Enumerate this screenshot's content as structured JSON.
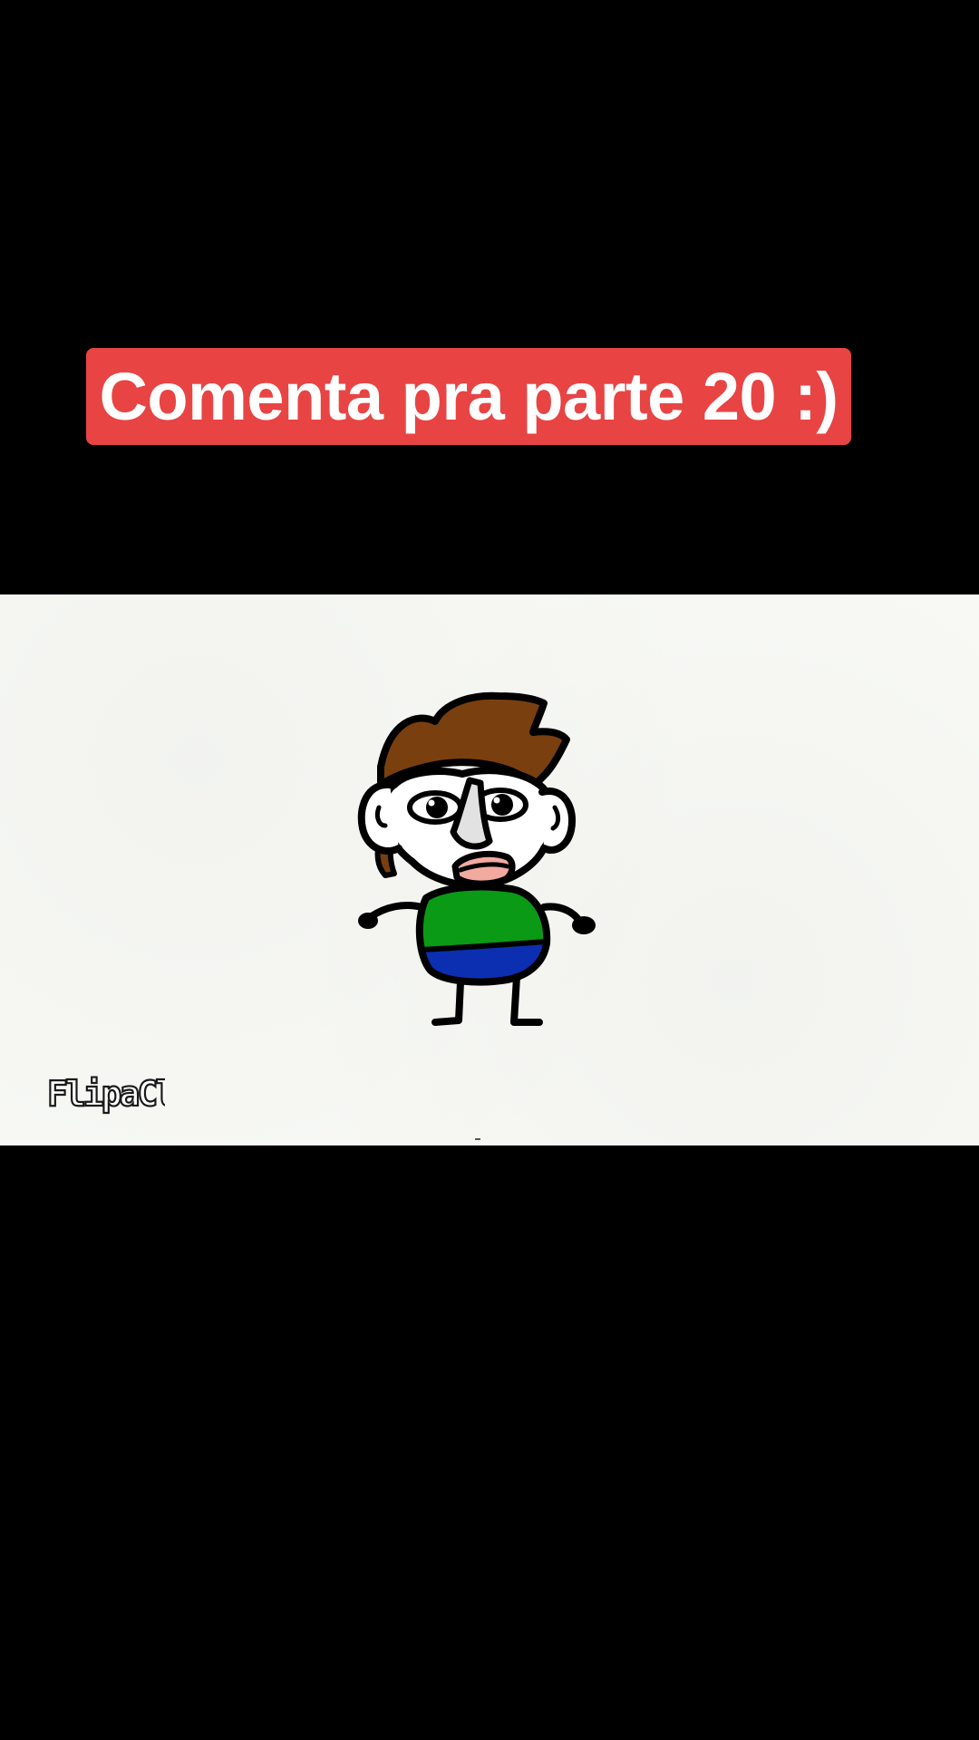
{
  "caption": {
    "text": "Comenta pra parte 20 :)",
    "background_color": "#e84444",
    "text_color": "#ffffff"
  },
  "video": {
    "background_color": "#f8f9f5",
    "watermark": "FlipaClip",
    "character": {
      "hair_color": "#7a3f0f",
      "shirt_color": "#0a9a16",
      "pants_color": "#0b2fb0",
      "mouth_color": "#f2aaa0",
      "nose_color": "#e2e2e2",
      "outline_color": "#000000"
    }
  }
}
